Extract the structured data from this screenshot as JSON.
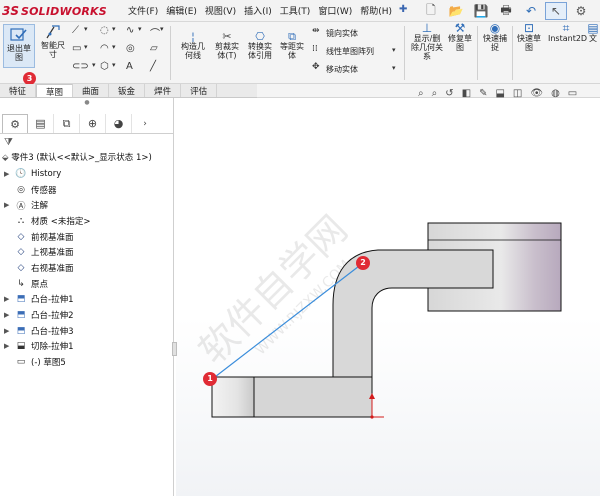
{
  "app": {
    "brand_prefix": "3S",
    "brand_name": "SOLIDWORKS"
  },
  "menu": [
    "文件(F)",
    "编辑(E)",
    "视图(V)",
    "插入(I)",
    "工具(T)",
    "窗口(W)",
    "帮助(H)"
  ],
  "ribbon": {
    "exit_sketch": "退出草图",
    "smart_dim": "智能尺寸",
    "construct_geom": "构造几何线",
    "trim_entities": "剪裁实体(T)",
    "convert_entities": "转换实体引用",
    "offset_entities": "等距实体",
    "mirror_entities": "镜向实体",
    "linear_pattern": "线性草图阵列",
    "move_entities": "移动实体",
    "show_delete_relations": "显示/删除几何关系",
    "repair_sketch": "修复草图",
    "quick_snaps": "快速捕捉",
    "rapid_sketch": "快速草图",
    "instant2d": "Instant2D",
    "more": "文"
  },
  "tabs": [
    "特征",
    "草图",
    "曲面",
    "钣金",
    "焊件",
    "评估"
  ],
  "active_tab": "草图",
  "feature_tree": {
    "root": "零件3 (默认<<默认>_显示状态 1>)",
    "items": [
      {
        "label": "History",
        "icon": "history-icon",
        "expandable": true
      },
      {
        "label": "传感器",
        "icon": "sensor-icon",
        "expandable": false
      },
      {
        "label": "注解",
        "icon": "annotation-icon",
        "expandable": true
      },
      {
        "label": "材质 <未指定>",
        "icon": "material-icon",
        "expandable": false
      },
      {
        "label": "前视基准面",
        "icon": "plane-icon",
        "expandable": false
      },
      {
        "label": "上视基准面",
        "icon": "plane-icon",
        "expandable": false
      },
      {
        "label": "右视基准面",
        "icon": "plane-icon",
        "expandable": false
      },
      {
        "label": "原点",
        "icon": "origin-icon",
        "expandable": false
      },
      {
        "label": "凸台-拉伸1",
        "icon": "extrude-icon",
        "expandable": true
      },
      {
        "label": "凸台-拉伸2",
        "icon": "extrude-icon",
        "expandable": true
      },
      {
        "label": "凸台-拉伸3",
        "icon": "extrude-icon",
        "expandable": true
      },
      {
        "label": "切除-拉伸1",
        "icon": "cut-extrude-icon",
        "expandable": true
      },
      {
        "label": "(-) 草图5",
        "icon": "sketch-icon",
        "expandable": false
      }
    ]
  },
  "markers": {
    "badge_ribbon": "3",
    "point_1": "1",
    "point_2": "2"
  },
  "watermark": "软件自学网 WWW.RJZXW.COM",
  "colors": {
    "accent": "#c8102e",
    "badge": "#e02b35",
    "sketch_line": "#3a8ddb",
    "part_fill": "#d9d9d9"
  }
}
